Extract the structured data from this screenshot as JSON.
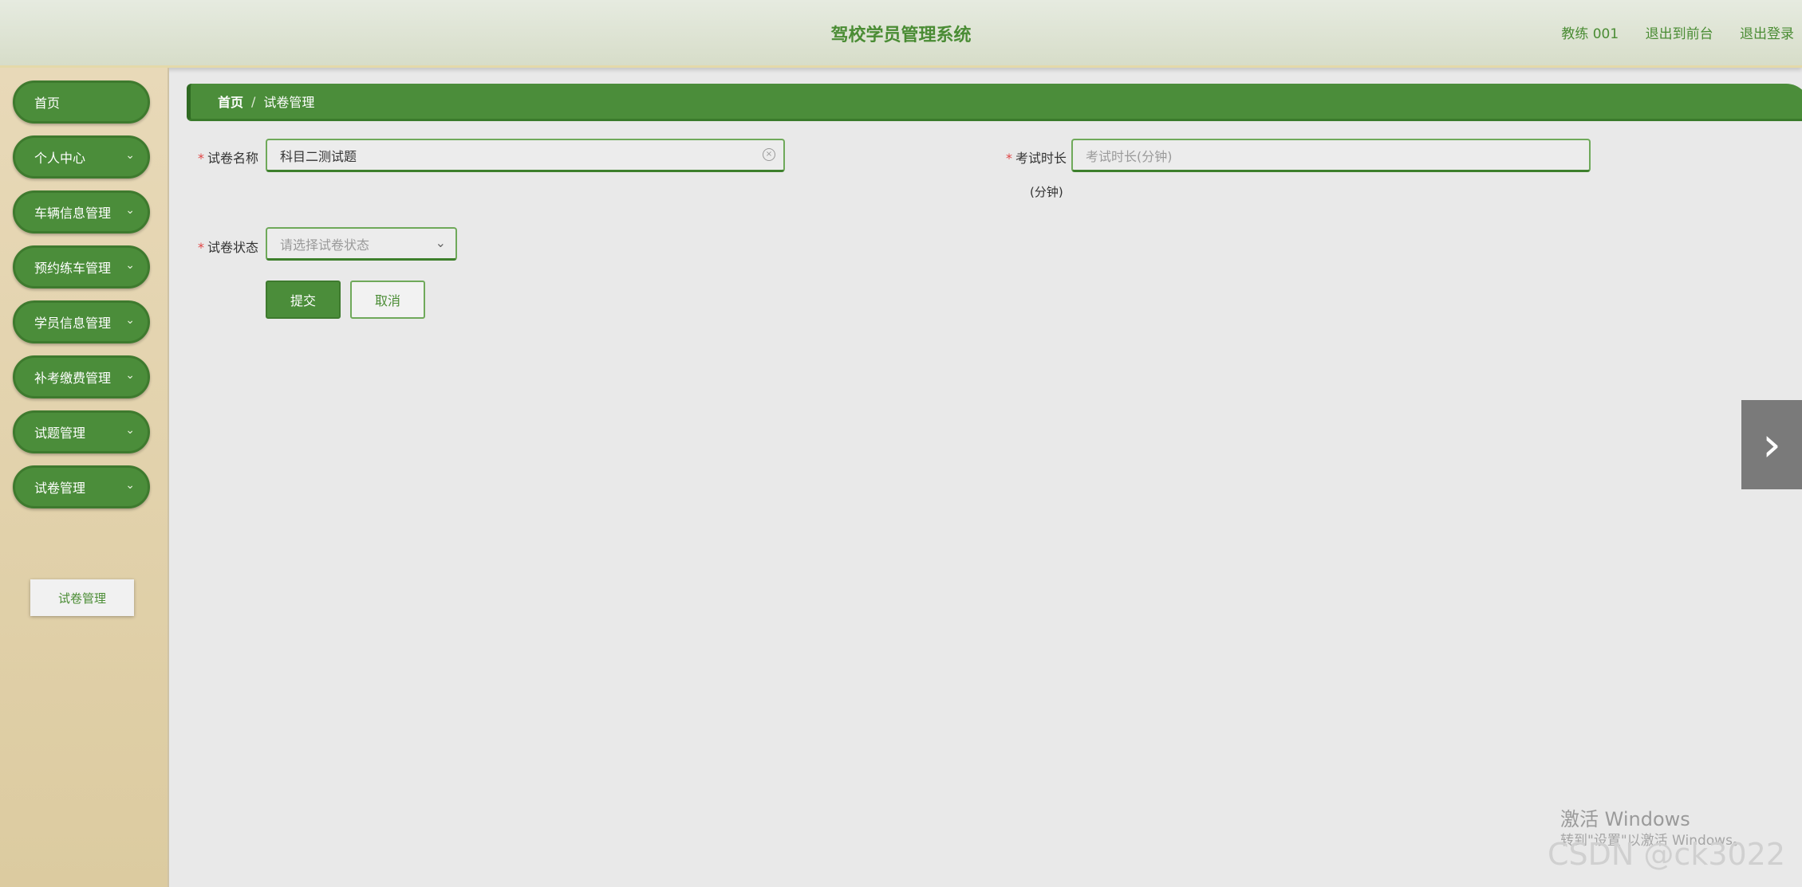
{
  "header": {
    "title": "驾校学员管理系统",
    "user": "教练 001",
    "front_link": "退出到前台",
    "logout_link": "退出登录"
  },
  "sidebar": {
    "items": [
      {
        "label": "首页"
      },
      {
        "label": "个人中心"
      },
      {
        "label": "车辆信息管理"
      },
      {
        "label": "预约练车管理"
      },
      {
        "label": "学员信息管理"
      },
      {
        "label": "补考缴费管理"
      },
      {
        "label": "试题管理"
      },
      {
        "label": "试卷管理"
      }
    ],
    "submenu": {
      "label": "试卷管理"
    }
  },
  "breadcrumb": {
    "home": "首页",
    "separator": "/",
    "current": "试卷管理"
  },
  "form": {
    "name_label": "试卷名称",
    "name_value": "科目二测试题",
    "duration_label": "考试时长",
    "duration_unit": "(分钟)",
    "duration_placeholder": "考试时长(分钟)",
    "status_label": "试卷状态",
    "status_placeholder": "请选择试卷状态",
    "submit": "提交",
    "cancel": "取消"
  },
  "watermark": {
    "line1": "激活 Windows",
    "line2": "转到\"设置\"以激活 Windows。",
    "csdn": "CSDN @ck3022"
  }
}
